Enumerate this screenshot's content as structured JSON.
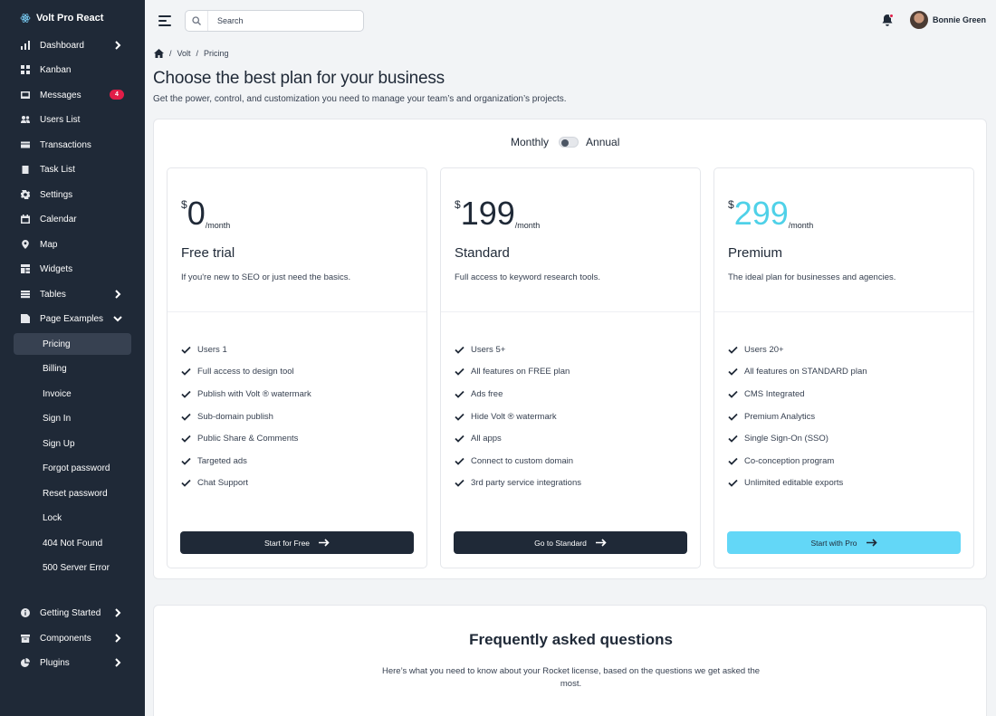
{
  "app": {
    "brand": "Volt Pro React"
  },
  "sidebar": {
    "items": [
      {
        "label": "Dashboard"
      },
      {
        "label": "Kanban"
      },
      {
        "label": "Messages",
        "badge": "4"
      },
      {
        "label": "Users List"
      },
      {
        "label": "Transactions"
      },
      {
        "label": "Task List"
      },
      {
        "label": "Settings"
      },
      {
        "label": "Calendar"
      },
      {
        "label": "Map"
      },
      {
        "label": "Widgets"
      },
      {
        "label": "Tables"
      },
      {
        "label": "Page Examples"
      }
    ],
    "sub_items": [
      {
        "label": "Pricing"
      },
      {
        "label": "Billing"
      },
      {
        "label": "Invoice"
      },
      {
        "label": "Sign In"
      },
      {
        "label": "Sign Up"
      },
      {
        "label": "Forgot password"
      },
      {
        "label": "Reset password"
      },
      {
        "label": "Lock"
      },
      {
        "label": "404 Not Found"
      },
      {
        "label": "500 Server Error"
      }
    ],
    "bottom_items": [
      {
        "label": "Getting Started"
      },
      {
        "label": "Components"
      },
      {
        "label": "Plugins"
      }
    ]
  },
  "topbar": {
    "search_placeholder": "Search",
    "user_name": "Bonnie Green"
  },
  "breadcrumb": {
    "items": [
      "Volt",
      "Pricing"
    ]
  },
  "header": {
    "title": "Choose the best plan for your business",
    "subtitle": "Get the power, control, and customization you need to manage your team’s and organization’s projects."
  },
  "billing_toggle": {
    "left_label": "Monthly",
    "right_label": "Annual"
  },
  "plans": [
    {
      "currency": "$",
      "amount": "0",
      "period": "/month",
      "name": "Free trial",
      "description": "If you're new to SEO or just need the basics.",
      "features": [
        "Users 1",
        "Full access to design tool",
        "Publish with Volt ® watermark",
        "Sub-domain publish",
        "Public Share & Comments",
        "Targeted ads",
        "Chat Support"
      ],
      "button": "Start for Free"
    },
    {
      "currency": "$",
      "amount": "199",
      "period": "/month",
      "name": "Standard",
      "description": "Full access to keyword research tools.",
      "features": [
        "Users 5+",
        "All features on FREE plan",
        "Ads free",
        "Hide Volt ® watermark",
        "All apps",
        "Connect to custom domain",
        "3rd party service integrations"
      ],
      "button": "Go to Standard"
    },
    {
      "currency": "$",
      "amount": "299",
      "period": "/month",
      "name": "Premium",
      "description": "The ideal plan for businesses and agencies.",
      "features": [
        "Users 20+",
        "All features on STANDARD plan",
        "CMS Integrated",
        "Premium Analytics",
        "Single Sign-On (SSO)",
        "Co-conception program",
        "Unlimited editable exports"
      ],
      "button": "Start with Pro"
    }
  ],
  "faq": {
    "title": "Frequently asked questions",
    "subtitle": "Here’s what you need to know about your Rocket license, based on the questions we get asked the most."
  },
  "colors": {
    "sidebar_bg": "#1f2937",
    "accent_cyan": "#63d7f7",
    "badge_red": "#e11d48"
  }
}
